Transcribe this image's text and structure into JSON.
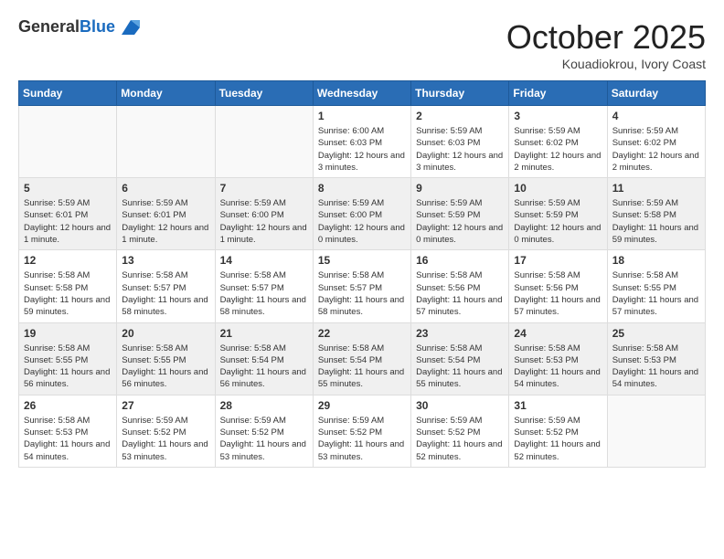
{
  "header": {
    "logo_general": "General",
    "logo_blue": "Blue",
    "title": "October 2025",
    "location": "Kouadiokrou, Ivory Coast"
  },
  "weekdays": [
    "Sunday",
    "Monday",
    "Tuesday",
    "Wednesday",
    "Thursday",
    "Friday",
    "Saturday"
  ],
  "weeks": [
    {
      "shaded": false,
      "days": [
        {
          "num": "",
          "sunrise": "",
          "sunset": "",
          "daylight": ""
        },
        {
          "num": "",
          "sunrise": "",
          "sunset": "",
          "daylight": ""
        },
        {
          "num": "",
          "sunrise": "",
          "sunset": "",
          "daylight": ""
        },
        {
          "num": "1",
          "sunrise": "Sunrise: 6:00 AM",
          "sunset": "Sunset: 6:03 PM",
          "daylight": "Daylight: 12 hours and 3 minutes."
        },
        {
          "num": "2",
          "sunrise": "Sunrise: 5:59 AM",
          "sunset": "Sunset: 6:03 PM",
          "daylight": "Daylight: 12 hours and 3 minutes."
        },
        {
          "num": "3",
          "sunrise": "Sunrise: 5:59 AM",
          "sunset": "Sunset: 6:02 PM",
          "daylight": "Daylight: 12 hours and 2 minutes."
        },
        {
          "num": "4",
          "sunrise": "Sunrise: 5:59 AM",
          "sunset": "Sunset: 6:02 PM",
          "daylight": "Daylight: 12 hours and 2 minutes."
        }
      ]
    },
    {
      "shaded": true,
      "days": [
        {
          "num": "5",
          "sunrise": "Sunrise: 5:59 AM",
          "sunset": "Sunset: 6:01 PM",
          "daylight": "Daylight: 12 hours and 1 minute."
        },
        {
          "num": "6",
          "sunrise": "Sunrise: 5:59 AM",
          "sunset": "Sunset: 6:01 PM",
          "daylight": "Daylight: 12 hours and 1 minute."
        },
        {
          "num": "7",
          "sunrise": "Sunrise: 5:59 AM",
          "sunset": "Sunset: 6:00 PM",
          "daylight": "Daylight: 12 hours and 1 minute."
        },
        {
          "num": "8",
          "sunrise": "Sunrise: 5:59 AM",
          "sunset": "Sunset: 6:00 PM",
          "daylight": "Daylight: 12 hours and 0 minutes."
        },
        {
          "num": "9",
          "sunrise": "Sunrise: 5:59 AM",
          "sunset": "Sunset: 5:59 PM",
          "daylight": "Daylight: 12 hours and 0 minutes."
        },
        {
          "num": "10",
          "sunrise": "Sunrise: 5:59 AM",
          "sunset": "Sunset: 5:59 PM",
          "daylight": "Daylight: 12 hours and 0 minutes."
        },
        {
          "num": "11",
          "sunrise": "Sunrise: 5:59 AM",
          "sunset": "Sunset: 5:58 PM",
          "daylight": "Daylight: 11 hours and 59 minutes."
        }
      ]
    },
    {
      "shaded": false,
      "days": [
        {
          "num": "12",
          "sunrise": "Sunrise: 5:58 AM",
          "sunset": "Sunset: 5:58 PM",
          "daylight": "Daylight: 11 hours and 59 minutes."
        },
        {
          "num": "13",
          "sunrise": "Sunrise: 5:58 AM",
          "sunset": "Sunset: 5:57 PM",
          "daylight": "Daylight: 11 hours and 58 minutes."
        },
        {
          "num": "14",
          "sunrise": "Sunrise: 5:58 AM",
          "sunset": "Sunset: 5:57 PM",
          "daylight": "Daylight: 11 hours and 58 minutes."
        },
        {
          "num": "15",
          "sunrise": "Sunrise: 5:58 AM",
          "sunset": "Sunset: 5:57 PM",
          "daylight": "Daylight: 11 hours and 58 minutes."
        },
        {
          "num": "16",
          "sunrise": "Sunrise: 5:58 AM",
          "sunset": "Sunset: 5:56 PM",
          "daylight": "Daylight: 11 hours and 57 minutes."
        },
        {
          "num": "17",
          "sunrise": "Sunrise: 5:58 AM",
          "sunset": "Sunset: 5:56 PM",
          "daylight": "Daylight: 11 hours and 57 minutes."
        },
        {
          "num": "18",
          "sunrise": "Sunrise: 5:58 AM",
          "sunset": "Sunset: 5:55 PM",
          "daylight": "Daylight: 11 hours and 57 minutes."
        }
      ]
    },
    {
      "shaded": true,
      "days": [
        {
          "num": "19",
          "sunrise": "Sunrise: 5:58 AM",
          "sunset": "Sunset: 5:55 PM",
          "daylight": "Daylight: 11 hours and 56 minutes."
        },
        {
          "num": "20",
          "sunrise": "Sunrise: 5:58 AM",
          "sunset": "Sunset: 5:55 PM",
          "daylight": "Daylight: 11 hours and 56 minutes."
        },
        {
          "num": "21",
          "sunrise": "Sunrise: 5:58 AM",
          "sunset": "Sunset: 5:54 PM",
          "daylight": "Daylight: 11 hours and 56 minutes."
        },
        {
          "num": "22",
          "sunrise": "Sunrise: 5:58 AM",
          "sunset": "Sunset: 5:54 PM",
          "daylight": "Daylight: 11 hours and 55 minutes."
        },
        {
          "num": "23",
          "sunrise": "Sunrise: 5:58 AM",
          "sunset": "Sunset: 5:54 PM",
          "daylight": "Daylight: 11 hours and 55 minutes."
        },
        {
          "num": "24",
          "sunrise": "Sunrise: 5:58 AM",
          "sunset": "Sunset: 5:53 PM",
          "daylight": "Daylight: 11 hours and 54 minutes."
        },
        {
          "num": "25",
          "sunrise": "Sunrise: 5:58 AM",
          "sunset": "Sunset: 5:53 PM",
          "daylight": "Daylight: 11 hours and 54 minutes."
        }
      ]
    },
    {
      "shaded": false,
      "days": [
        {
          "num": "26",
          "sunrise": "Sunrise: 5:58 AM",
          "sunset": "Sunset: 5:53 PM",
          "daylight": "Daylight: 11 hours and 54 minutes."
        },
        {
          "num": "27",
          "sunrise": "Sunrise: 5:59 AM",
          "sunset": "Sunset: 5:52 PM",
          "daylight": "Daylight: 11 hours and 53 minutes."
        },
        {
          "num": "28",
          "sunrise": "Sunrise: 5:59 AM",
          "sunset": "Sunset: 5:52 PM",
          "daylight": "Daylight: 11 hours and 53 minutes."
        },
        {
          "num": "29",
          "sunrise": "Sunrise: 5:59 AM",
          "sunset": "Sunset: 5:52 PM",
          "daylight": "Daylight: 11 hours and 53 minutes."
        },
        {
          "num": "30",
          "sunrise": "Sunrise: 5:59 AM",
          "sunset": "Sunset: 5:52 PM",
          "daylight": "Daylight: 11 hours and 52 minutes."
        },
        {
          "num": "31",
          "sunrise": "Sunrise: 5:59 AM",
          "sunset": "Sunset: 5:52 PM",
          "daylight": "Daylight: 11 hours and 52 minutes."
        },
        {
          "num": "",
          "sunrise": "",
          "sunset": "",
          "daylight": ""
        }
      ]
    }
  ]
}
